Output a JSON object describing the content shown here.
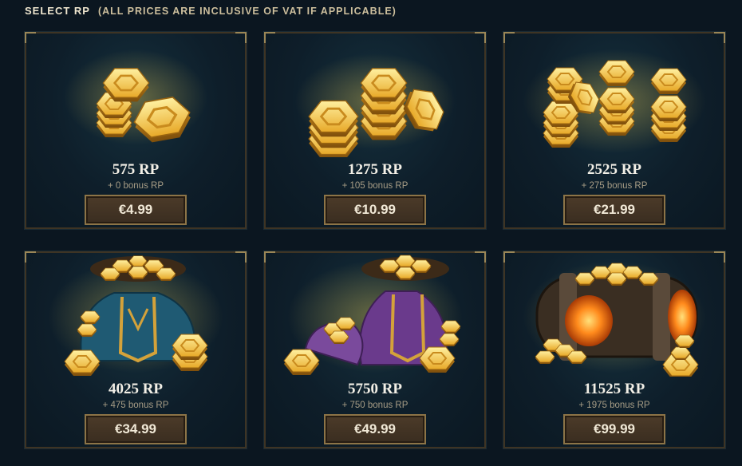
{
  "header": {
    "title": "SELECT RP",
    "note": "(ALL PRICES ARE INCLUSIVE OF VAT IF APPLICABLE)"
  },
  "colors": {
    "gold": "#e9b233",
    "gold_light": "#ffe27a",
    "gold_dark": "#a86f12",
    "bag_blue": "#1f5a73",
    "bag_purple": "#6a3a8c",
    "chest_fire": "#ff7a1a"
  },
  "packages": [
    {
      "rp": "575 RP",
      "bonus": "+ 0 bonus RP",
      "price": "€4.99",
      "art": "small-stack-icon"
    },
    {
      "rp": "1275 RP",
      "bonus": "+ 105 bonus RP",
      "price": "€10.99",
      "art": "medium-stack-icon"
    },
    {
      "rp": "2525 RP",
      "bonus": "+ 275 bonus RP",
      "price": "€21.99",
      "art": "large-stack-icon"
    },
    {
      "rp": "4025 RP",
      "bonus": "+ 475 bonus RP",
      "price": "€34.99",
      "art": "blue-bag-icon"
    },
    {
      "rp": "5750 RP",
      "bonus": "+ 750 bonus RP",
      "price": "€49.99",
      "art": "purple-bag-icon"
    },
    {
      "rp": "11525 RP",
      "bonus": "+ 1975 bonus RP",
      "price": "€99.99",
      "art": "treasure-chest-icon"
    }
  ]
}
